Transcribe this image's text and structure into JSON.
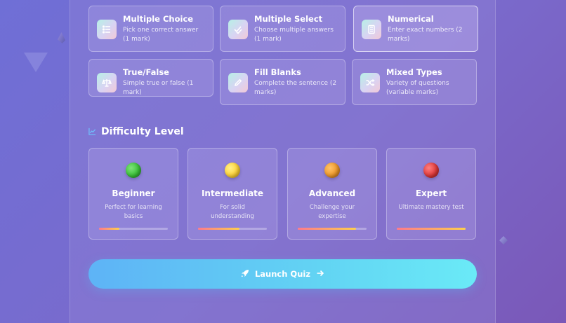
{
  "question_types": [
    {
      "title": "Multiple Choice",
      "desc": "Pick one correct answer (1 mark)",
      "icon": "list-icon",
      "selected": false
    },
    {
      "title": "Multiple Select",
      "desc": "Choose multiple answers (1 mark)",
      "icon": "double-check-icon",
      "selected": false
    },
    {
      "title": "Numerical",
      "desc": "Enter exact numbers (2 marks)",
      "icon": "calculator-icon",
      "selected": true
    },
    {
      "title": "True/False",
      "desc": "Simple true or false (1 mark)",
      "icon": "balance-scale-icon",
      "selected": false
    },
    {
      "title": "Fill Blanks",
      "desc": "Complete the sentence (2 marks)",
      "icon": "pencil-icon",
      "selected": false
    },
    {
      "title": "Mixed Types",
      "desc": "Variety of questions (variable marks)",
      "icon": "shuffle-icon",
      "selected": false
    }
  ],
  "difficulty": {
    "title": "Difficulty Level",
    "icon": "chart-line-icon",
    "levels": [
      {
        "name": "Beginner",
        "desc": "Perfect for learning basics",
        "color": "#3cc43a",
        "progress": 0.3
      },
      {
        "name": "Intermediate",
        "desc": "For solid understanding",
        "color": "#ffd43a",
        "progress": 0.6
      },
      {
        "name": "Advanced",
        "desc": "Challenge your expertise",
        "color": "#f09a2c",
        "progress": 0.85
      },
      {
        "name": "Expert",
        "desc": "Ultimate mastery test",
        "color": "#e23b3b",
        "progress": 1.0
      }
    ]
  },
  "launch": {
    "label": "Launch Quiz",
    "icon_left": "rocket-icon",
    "icon_right": "arrow-right-icon"
  },
  "colors": {
    "accent": "#62d4f3",
    "bar_start": "#ff7a8a",
    "bar_end": "#ffd04a"
  }
}
